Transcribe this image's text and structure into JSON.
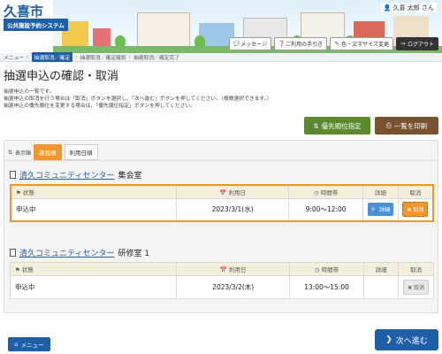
{
  "header": {
    "logo_title": "久喜市",
    "logo_subtitle": "公共施設予約システム",
    "user_name": "久喜 太郎 さん",
    "links": [
      {
        "label": "メッセージ",
        "icon": "chat-icon"
      },
      {
        "label": "ご利用の手引き",
        "icon": "guide-icon"
      },
      {
        "label": "色・文字サイズ変更",
        "icon": "palette-icon"
      },
      {
        "label": "ログアウト",
        "icon": "logout-icon"
      }
    ]
  },
  "breadcrumb": {
    "items": [
      "メニュー",
      "抽選取消／確定",
      "抽選取消／確定確認",
      "抽選取消／確定完了"
    ],
    "active_index": 1
  },
  "page": {
    "title": "抽選申込の確認・取消",
    "description": [
      "抽選申込の一覧です。",
      "抽選申込の取消を行う場合は「取消」ボタンを選択し、「次へ進む」ボタンを押してください。（複数選択できます。）",
      "抽選申込の優先順位を変更する場合は、「優先順位指定」ボタンを押してください。"
    ]
  },
  "actions": {
    "priority_label": "優先順位指定",
    "print_label": "一覧を印刷"
  },
  "sort": {
    "label": "表示順",
    "options": [
      "施設順",
      "利用日順"
    ],
    "active_index": 0
  },
  "table_headers": {
    "status": "状態",
    "date": "利用日",
    "time": "時間帯",
    "detail": "詳細",
    "cancel": "取消"
  },
  "reservations": [
    {
      "facility": "清久コミュニティセンター",
      "room": "集会室",
      "status": "申込中",
      "date": "2023/3/1(水)",
      "time": "9:00～12:00",
      "detail_label": "詳細",
      "cancel_label": "取消",
      "cancel_selected": true
    },
    {
      "facility": "清久コミュニティセンター",
      "room": "研修室 1",
      "status": "申込中",
      "date": "2023/3/2(木)",
      "time": "13:00～15:00",
      "detail_label": "詳細",
      "cancel_label": "取消",
      "cancel_selected": false
    }
  ],
  "footer": {
    "menu_label": "メニュー",
    "next_label": "次へ進む"
  },
  "colors": {
    "primary": "#1e5fa8",
    "accent_orange": "#f0962d",
    "priority_green": "#5b8a2e",
    "print_brown": "#7a5230",
    "table_header_bg": "#f5f0da"
  }
}
